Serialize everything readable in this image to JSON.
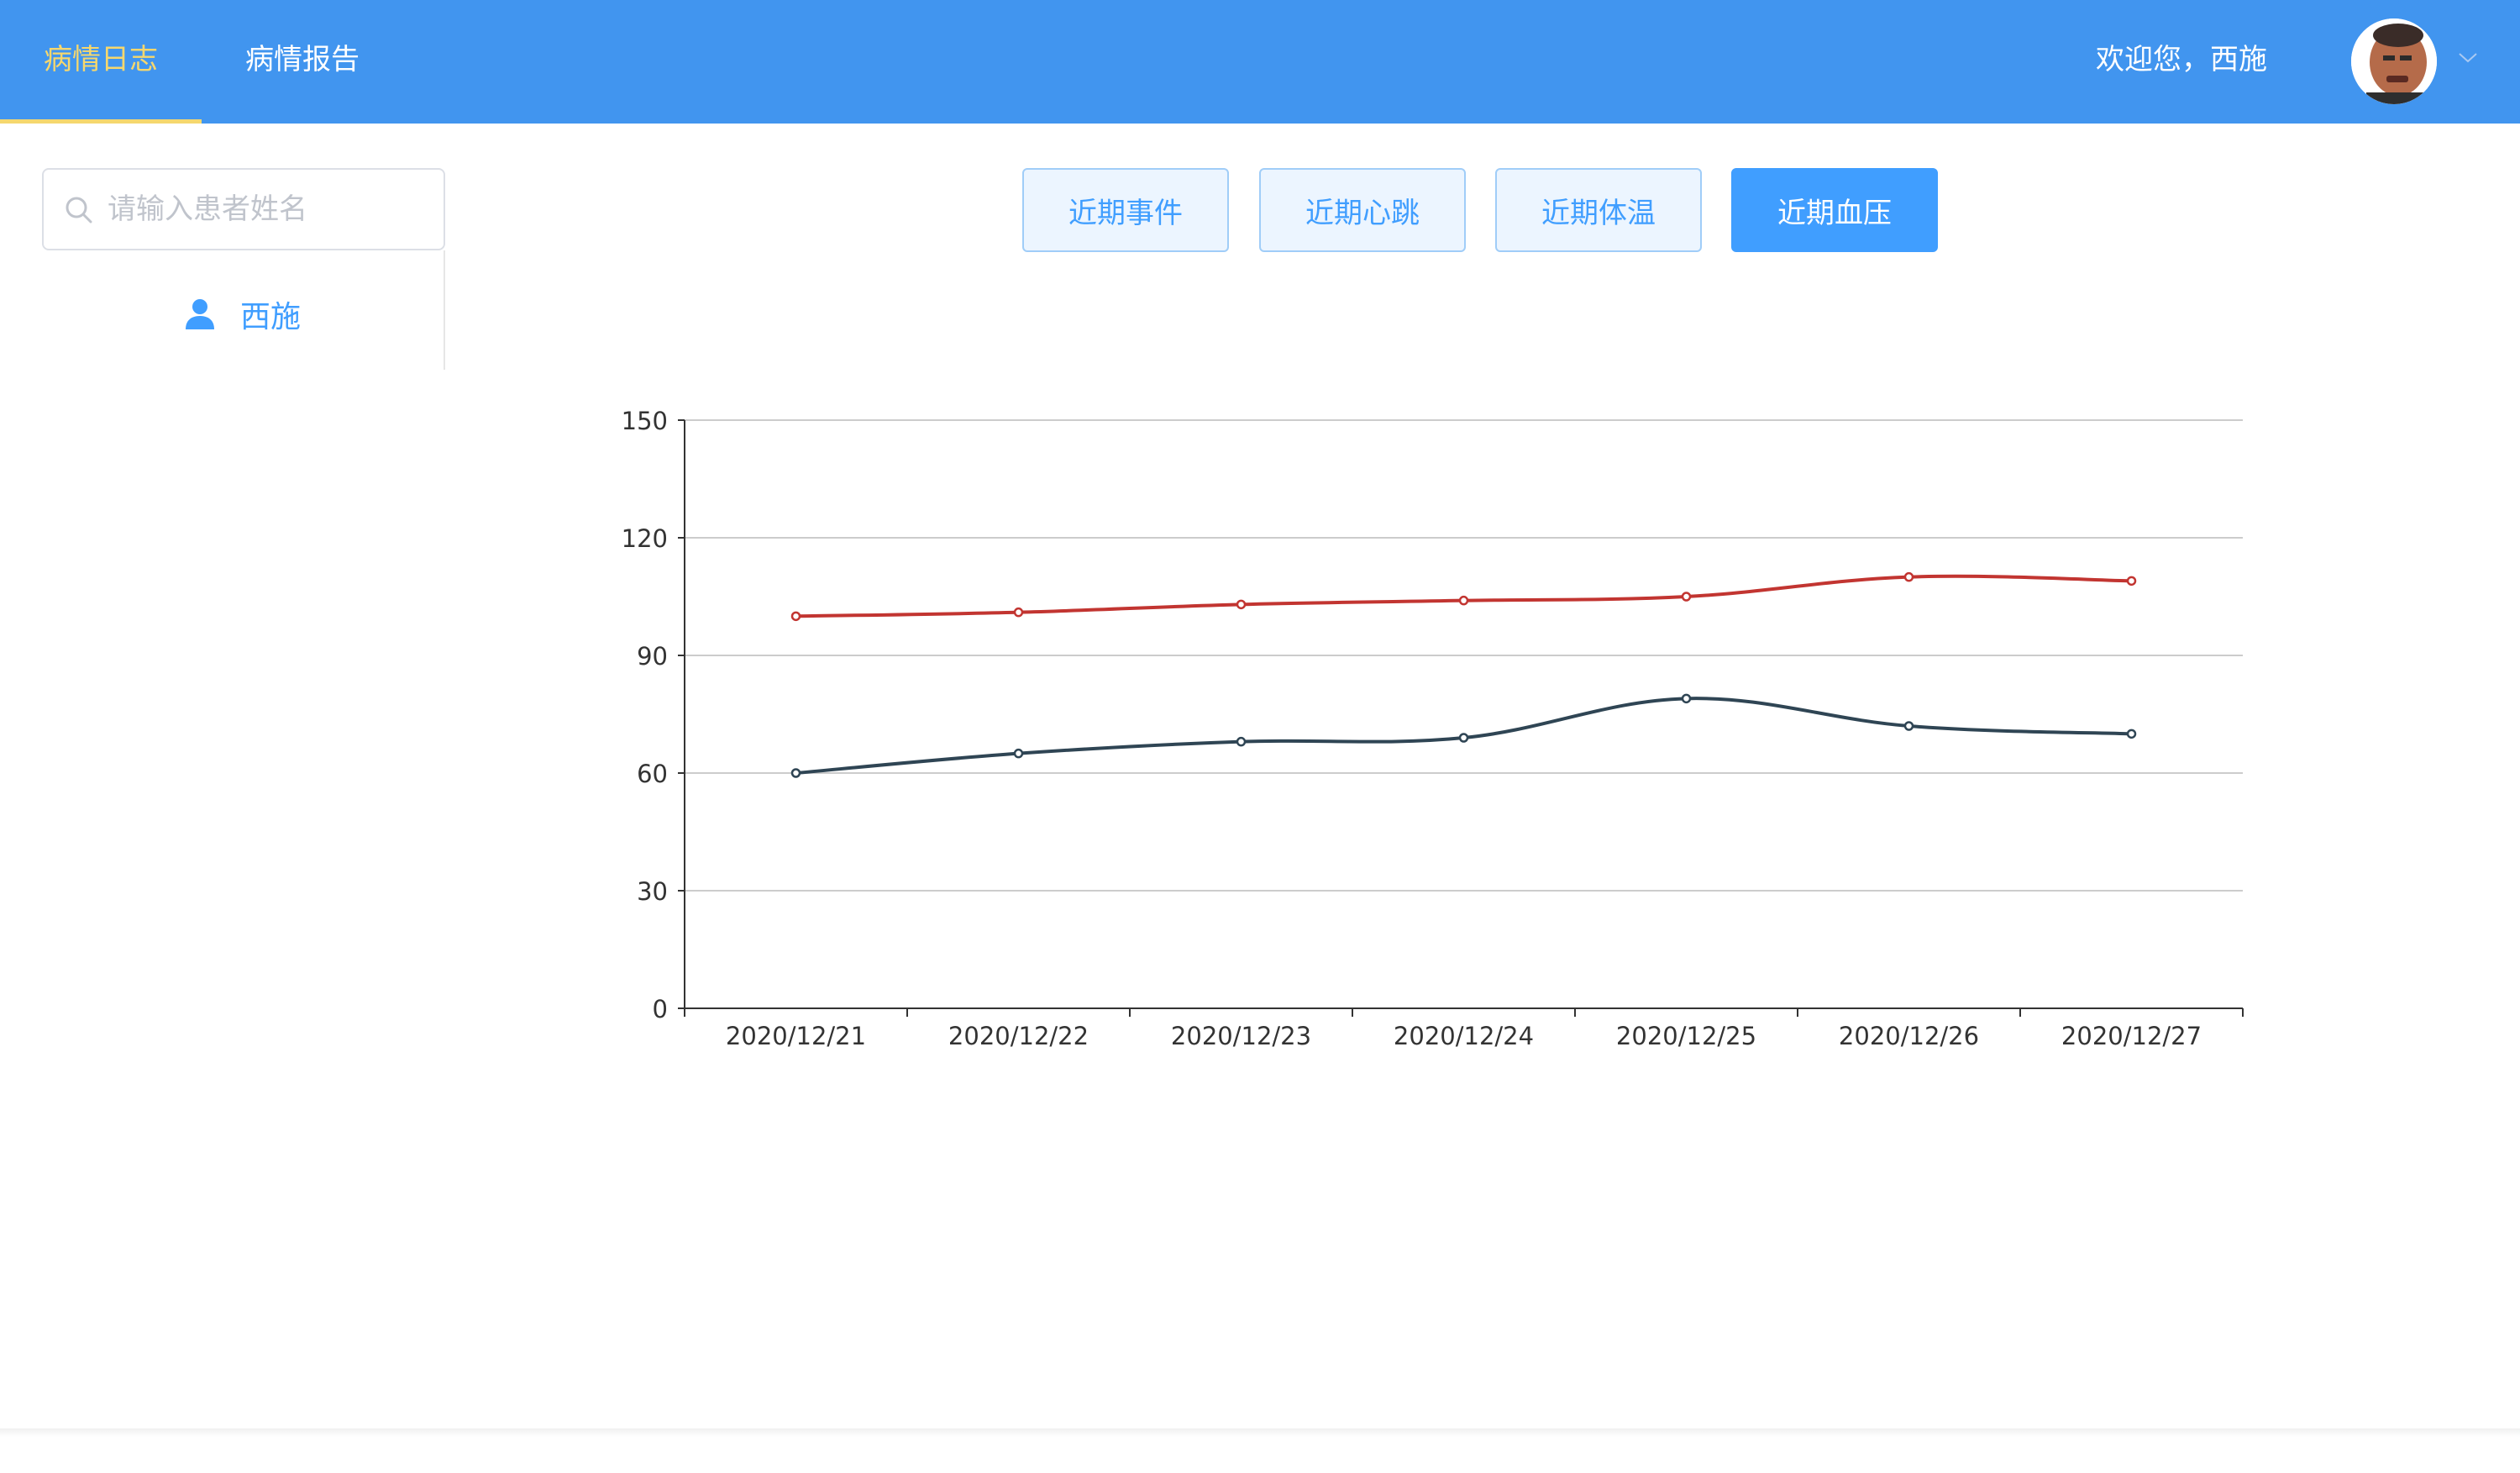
{
  "nav": {
    "tabs": [
      {
        "label": "病情日志",
        "active": true
      },
      {
        "label": "病情报告",
        "active": false
      }
    ],
    "welcome": "欢迎您，西施",
    "accent_color": "#f5d76e"
  },
  "sidebar": {
    "search_placeholder": "请输入患者姓名",
    "patients": [
      "西施"
    ]
  },
  "segments": [
    {
      "label": "近期事件",
      "active": false
    },
    {
      "label": "近期心跳",
      "active": false
    },
    {
      "label": "近期体温",
      "active": false
    },
    {
      "label": "近期血压",
      "active": true
    }
  ],
  "chart_data": {
    "type": "line",
    "categories": [
      "2020/12/21",
      "2020/12/22",
      "2020/12/23",
      "2020/12/24",
      "2020/12/25",
      "2020/12/26",
      "2020/12/27"
    ],
    "series": [
      {
        "values": [
          100,
          101,
          103,
          104,
          105,
          110,
          109
        ],
        "color": "#c23531"
      },
      {
        "values": [
          60,
          65,
          68,
          69,
          79,
          72,
          70
        ],
        "color": "#2f4554"
      }
    ],
    "ylim": [
      0,
      150
    ],
    "yticks": [
      0,
      30,
      60,
      90,
      120,
      150
    ],
    "smooth": true,
    "grid": "horizontal"
  }
}
